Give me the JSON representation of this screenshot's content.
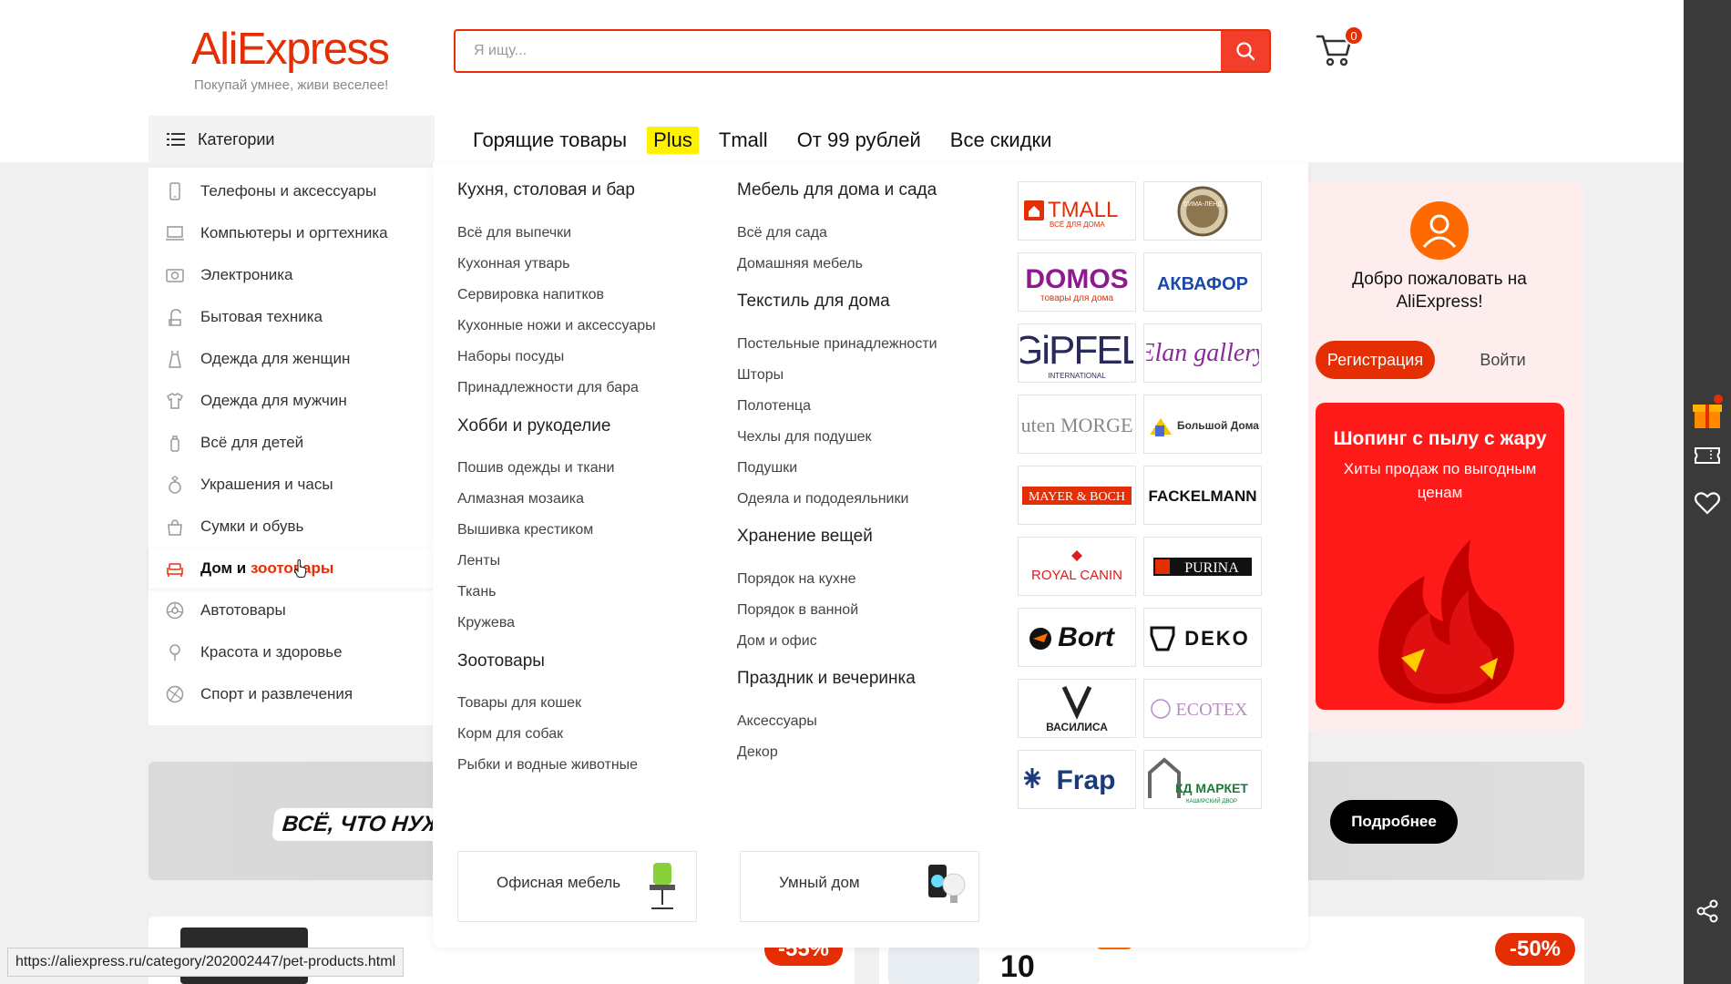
{
  "header": {
    "logo_text": "AliExpress",
    "logo_tagline": "Покупай умнее, живи веселее!",
    "search_placeholder": "Я ищу...",
    "cart_count": "0"
  },
  "nav": {
    "categories_label": "Категории",
    "links": [
      "Горящие товары",
      "Plus",
      "Tmall",
      "От 99 рублей",
      "Все скидки"
    ]
  },
  "sidebar": {
    "items": [
      {
        "label": "Телефоны и аксессуары",
        "icon": "phone-icon"
      },
      {
        "label": "Компьютеры и оргтехника",
        "icon": "laptop-icon"
      },
      {
        "label": "Электроника",
        "icon": "camera-icon"
      },
      {
        "label": "Бытовая техника",
        "icon": "appliance-icon"
      },
      {
        "label": "Одежда для женщин",
        "icon": "dress-icon"
      },
      {
        "label": "Одежда для мужчин",
        "icon": "shirt-icon"
      },
      {
        "label": "Всё для детей",
        "icon": "bottle-icon"
      },
      {
        "label": "Украшения и часы",
        "icon": "ring-icon"
      },
      {
        "label": "Сумки и обувь",
        "icon": "bag-icon"
      },
      {
        "label_part1": "Дом и ",
        "label_part2": "зоотовары",
        "icon": "sofa-icon",
        "active": true
      },
      {
        "label": "Автотовары",
        "icon": "wheel-icon"
      },
      {
        "label": "Красота и здоровье",
        "icon": "beauty-icon"
      },
      {
        "label": "Спорт и развлечения",
        "icon": "ball-icon"
      }
    ]
  },
  "mega": {
    "col1": {
      "groups": [
        {
          "title": "Кухня, столовая и бар",
          "links": [
            "Всё для выпечки",
            "Кухонная утварь",
            "Сервировка напитков",
            "Кухонные ножи и аксессуары",
            "Наборы посуды",
            "Принадлежности для бара"
          ]
        },
        {
          "title": "Хобби и рукоделие",
          "links": [
            "Пошив одежды и ткани",
            "Алмазная мозаика",
            "Вышивка крестиком",
            "Ленты",
            "Ткань",
            "Кружева"
          ]
        },
        {
          "title": "Зоотовары",
          "links": [
            "Товары для кошек",
            "Корм для собак",
            "Рыбки и водные животные"
          ]
        }
      ]
    },
    "col2": {
      "groups": [
        {
          "title": "Мебель для дома и сада",
          "links": [
            "Всё для сада",
            "Домашняя мебель"
          ]
        },
        {
          "title": "Текстиль для дома",
          "links": [
            "Постельные принадлежности",
            "Шторы",
            "Полотенца",
            "Чехлы для подушек",
            "Подушки",
            "Одеяла и пододеяльники"
          ]
        },
        {
          "title": "Хранение вещей",
          "links": [
            "Порядок на кухне",
            "Порядок в ванной",
            "Дом и офис"
          ]
        },
        {
          "title": "Праздник и вечеринка",
          "links": [
            "Аксессуары",
            "Декор"
          ]
        }
      ]
    },
    "brands": [
      {
        "text": "TMALL",
        "sub": "ВСЁ ДЛЯ ДОМА",
        "color": "#e62e04"
      },
      {
        "text": "СИМА-ЛЕНД",
        "color": "#6b5a3a"
      },
      {
        "text": "DOMOS",
        "sub": "товары для дома",
        "color": "#8e1a8e"
      },
      {
        "text": "АКВАФОР",
        "color": "#1a4aa8"
      },
      {
        "text": "GiPFEL",
        "sub": "INTERNATIONAL",
        "color": "#2a2a5a"
      },
      {
        "text": "Elan gallery",
        "color": "#8a2a9a"
      },
      {
        "text": "Guten MORGEN",
        "color": "#888888"
      },
      {
        "text": "Большой Домашний",
        "color": "#333333"
      },
      {
        "text": "MAYER & BOCH",
        "color": "#e62e04"
      },
      {
        "text": "FACKELMANN",
        "color": "#111111"
      },
      {
        "text": "ROYAL CANIN",
        "color": "#d81e1e"
      },
      {
        "text": "PURINA",
        "color": "#e62e04"
      },
      {
        "text": "Bort",
        "color": "#111111"
      },
      {
        "text": "DEKO",
        "color": "#111111"
      },
      {
        "text": "ВАСИЛИСА",
        "color": "#222222"
      },
      {
        "text": "ECOTEX",
        "color": "#b58fc0"
      },
      {
        "text": "Frap",
        "color": "#1a3a7a"
      },
      {
        "text": "КД МАРКЕТ",
        "sub": "КАШИРСКИЙ ДВОР",
        "color": "#1a7a3a"
      }
    ],
    "cards": [
      {
        "label": "Офисная мебель"
      },
      {
        "label": "Умный дом"
      }
    ]
  },
  "welcome": {
    "text": "Добро пожаловать на AliExpress!",
    "register_label": "Регистрация",
    "login_label": "Войти",
    "promo_title": "Шопинг с пылу с жару",
    "promo_subtitle": "Хиты продаж по выгодным ценам"
  },
  "banner": {
    "text": "ВСЁ, ЧТО НУЖ",
    "button_label": "Подробнее"
  },
  "products": {
    "discount1": "-55%",
    "discount2": "-50%",
    "badge_number": "10"
  },
  "status_url": "https://aliexpress.ru/category/202002447/pet-products.html",
  "colors": {
    "brand_red": "#e62e04",
    "accent_yellow": "#fff200",
    "right_bar": "#3a3a3a"
  }
}
